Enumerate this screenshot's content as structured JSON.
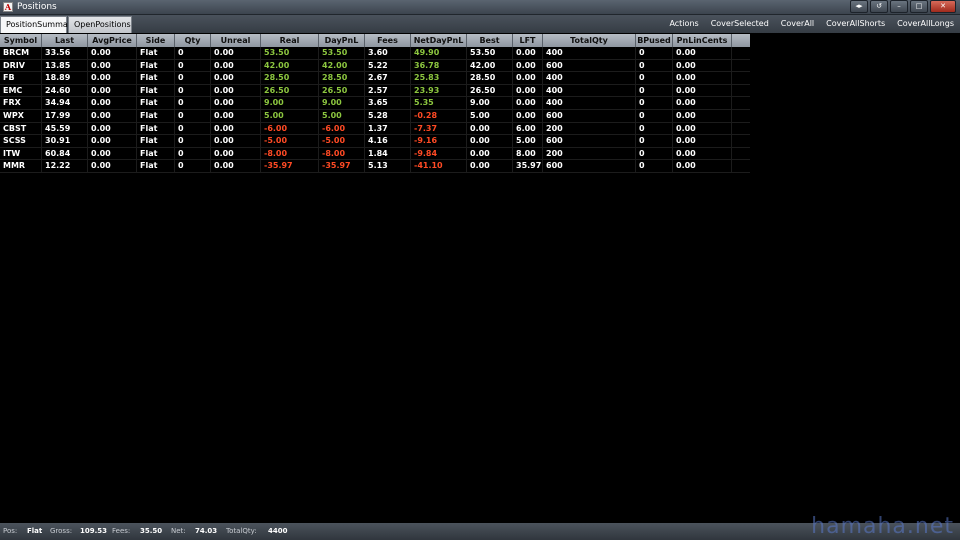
{
  "window": {
    "title": "Positions",
    "app_icon_letter": "A",
    "controls": [
      "fullscreen-icon",
      "restore-icon",
      "minimize-icon",
      "maximize-icon",
      "close-icon"
    ]
  },
  "tabs": [
    {
      "label": "PositionSummary",
      "active": true
    },
    {
      "label": "OpenPositions",
      "active": false
    }
  ],
  "menu": [
    "Actions",
    "CoverSelected",
    "CoverAll",
    "CoverAllShorts",
    "CoverAllLongs"
  ],
  "columns": [
    "Symbol",
    "Last",
    "AvgPrice",
    "Side",
    "Qty",
    "Unreal",
    "Real",
    "DayPnL",
    "Fees",
    "NetDayPnL",
    "Best",
    "LFT",
    "TotalQty",
    "BPused",
    "PnLinCents"
  ],
  "rows": [
    [
      "BRCM",
      "33.56",
      "0.00",
      "Flat",
      "0",
      "0.00",
      "53.50",
      "53.50",
      "3.60",
      "49.90",
      "53.50",
      "0.00",
      "400",
      "0",
      "0.00"
    ],
    [
      "DRIV",
      "13.85",
      "0.00",
      "Flat",
      "0",
      "0.00",
      "42.00",
      "42.00",
      "5.22",
      "36.78",
      "42.00",
      "0.00",
      "600",
      "0",
      "0.00"
    ],
    [
      "FB",
      "18.89",
      "0.00",
      "Flat",
      "0",
      "0.00",
      "28.50",
      "28.50",
      "2.67",
      "25.83",
      "28.50",
      "0.00",
      "400",
      "0",
      "0.00"
    ],
    [
      "EMC",
      "24.60",
      "0.00",
      "Flat",
      "0",
      "0.00",
      "26.50",
      "26.50",
      "2.57",
      "23.93",
      "26.50",
      "0.00",
      "400",
      "0",
      "0.00"
    ],
    [
      "FRX",
      "34.94",
      "0.00",
      "Flat",
      "0",
      "0.00",
      "9.00",
      "9.00",
      "3.65",
      "5.35",
      "9.00",
      "0.00",
      "400",
      "0",
      "0.00"
    ],
    [
      "WPX",
      "17.99",
      "0.00",
      "Flat",
      "0",
      "0.00",
      "5.00",
      "5.00",
      "5.28",
      "-0.28",
      "5.00",
      "0.00",
      "600",
      "0",
      "0.00"
    ],
    [
      "CBST",
      "45.59",
      "0.00",
      "Flat",
      "0",
      "0.00",
      "-6.00",
      "-6.00",
      "1.37",
      "-7.37",
      "0.00",
      "6.00",
      "200",
      "0",
      "0.00"
    ],
    [
      "SCSS",
      "30.91",
      "0.00",
      "Flat",
      "0",
      "0.00",
      "-5.00",
      "-5.00",
      "4.16",
      "-9.16",
      "0.00",
      "5.00",
      "600",
      "0",
      "0.00"
    ],
    [
      "ITW",
      "60.84",
      "0.00",
      "Flat",
      "0",
      "0.00",
      "-8.00",
      "-8.00",
      "1.84",
      "-9.84",
      "0.00",
      "8.00",
      "200",
      "0",
      "0.00"
    ],
    [
      "MMR",
      "12.22",
      "0.00",
      "Flat",
      "0",
      "0.00",
      "-35.97",
      "-35.97",
      "5.13",
      "-41.10",
      "0.00",
      "35.97",
      "600",
      "0",
      "0.00"
    ]
  ],
  "status": {
    "pos_label": "Pos:",
    "pos_value": "Flat",
    "gross_label": "Gross:",
    "gross_value": "109.53",
    "fees_label": "Fees:",
    "fees_value": "35.50",
    "net_label": "Net:",
    "net_value": "74.03",
    "totalqty_label": "TotalQty:",
    "totalqty_value": "4400"
  },
  "watermark": "hamaha.net",
  "colors": {
    "positive": "#8cc63f",
    "negative": "#ff4a24",
    "background": "#000000",
    "header": "#a8aeb6"
  }
}
